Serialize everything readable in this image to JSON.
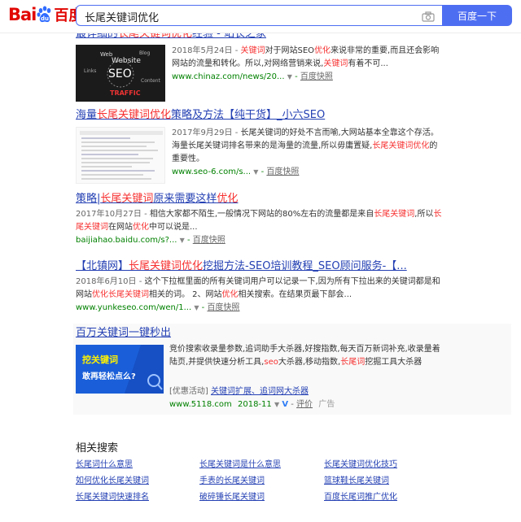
{
  "header": {
    "logo_bai": "Bai",
    "logo_du": "百度",
    "search_value": "长尾关键词优化",
    "search_button": "百度一下",
    "brand_color": "#4e6ef2"
  },
  "results": [
    {
      "title_parts": [
        "最详细的",
        "长尾关键词优化",
        "经验 - 站长之家"
      ],
      "date": "2018年5月24日 - ",
      "abstract": [
        "",
        "关键词",
        "对于网站SEO",
        "优化",
        "来说非常的重要,而且还会影响网站的流量和转化。所以,对网络营销来说,",
        "关键词",
        "有着不可..."
      ],
      "url": "www.chinaz.com/news/20...",
      "snapshot": "百度快照"
    },
    {
      "title_parts": [
        "海量",
        "长尾关键词优化",
        "策略及方法【纯干货】_小六SEO"
      ],
      "date": "2017年9月29日 - ",
      "abstract": [
        "长尾关键词的好处不言而喻,大网站基本全靠这个存活。海量长尾关键词排名带来的是海量的流量,所以毋庸置疑,",
        "长尾关键词优化",
        "的重要性。"
      ],
      "url": "www.seo-6.com/s...",
      "snapshot": "百度快照"
    },
    {
      "title_parts": [
        "策略|",
        "长尾关键词",
        "原来需要这样",
        "优化"
      ],
      "date": "2017年10月27日 - ",
      "abstract": [
        "相信大家都不陌生,一般情况下网站的80%左右的流量都是来自",
        "长尾关键词",
        ",所以",
        "长尾关键词",
        "在网站",
        "优化",
        "中可以说是..."
      ],
      "url": "baijiahao.baidu.com/s?...",
      "snapshot": "百度快照"
    },
    {
      "title_parts": [
        "【北镇网】",
        "长尾关键词优化",
        "挖掘方法-SEO培训教程_SEO顾问服务-【..."
      ],
      "date": "2018年6月10日 - ",
      "abstract": [
        "这个下拉框里面的所有关键词用户可以记录一下,因为所有下拉出来的关键词都是和网站",
        "优化长尾关键词",
        "相关的词。 2、网站",
        "优化",
        "相关搜索。在结果页最下部会..."
      ],
      "url": "www.yunkeseo.com/wen/1...",
      "snapshot": "百度快照"
    }
  ],
  "ad": {
    "title": "百万关键词一键秒出",
    "abstract_parts": [
      "竞价搜索收录量参数,追词助手大杀器,好搜指数,每天百万新词补充,收录量着陆页,并提供快速分析工具,",
      "seo",
      "大杀器,移动指数,",
      "长尾词",
      "挖掘工具大杀器"
    ],
    "sub_prefix": "[优惠活动]",
    "sub_link": "关键词扩展、追词网大杀器",
    "url": "www.5118.com",
    "date": "2018-11",
    "rating": "评价",
    "ad_tag": "广告",
    "banner_line1": "挖关键词",
    "banner_line2": "敢再轻松点么?"
  },
  "related": {
    "heading": "相关搜索",
    "items": [
      "长尾词什么意思",
      "长尾关键词是什么意思",
      "长尾关键词优化技巧",
      "如何优化长尾关键词",
      "手表的长尾关键词",
      "篮球鞋长尾关键词",
      "长尾关键词快速排名",
      "破碎锤长尾关键词",
      "百度长尾词推广优化"
    ]
  },
  "thumbs": {
    "t1_words": [
      "Web",
      "Website",
      "Blog",
      "SEO",
      "TRAFFIC",
      "Links",
      "Content"
    ]
  }
}
